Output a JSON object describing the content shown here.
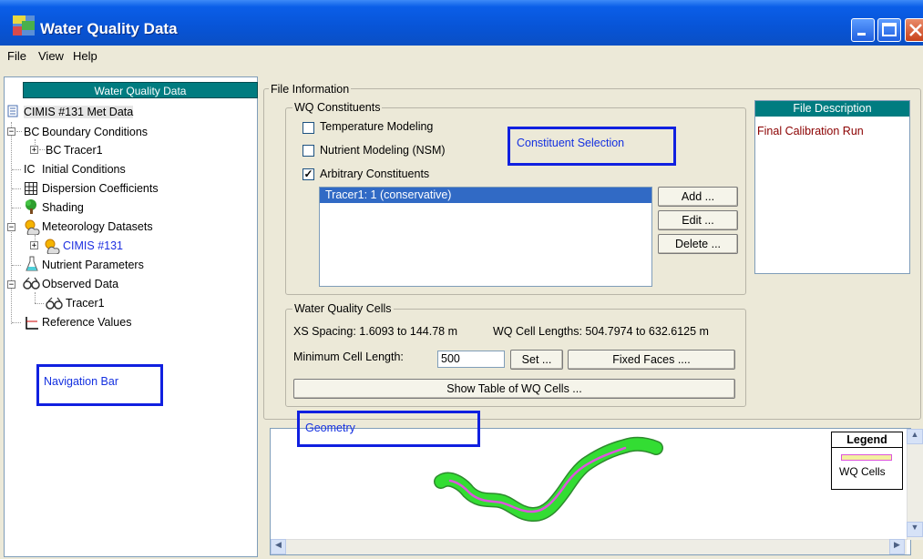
{
  "window": {
    "title": "Water Quality Data"
  },
  "menu": [
    "File",
    "View",
    "Help"
  ],
  "nav": {
    "header": "Water Quality Data",
    "items": [
      "CIMIS #131 Met Data",
      "Boundary Conditions",
      "Tracer1",
      "Initial Conditions",
      "Dispersion Coefficients",
      "Shading",
      "Meteorology Datasets",
      "CIMIS #131",
      "Nutrient Parameters",
      "Observed Data",
      "Tracer1",
      "Reference Values"
    ],
    "bc_prefix": "BC",
    "ic_prefix": "IC"
  },
  "annotations": {
    "navigation_bar": "Navigation Bar",
    "constituent_selection": "Constituent Selection",
    "geometry": "Geometry"
  },
  "file_info": {
    "legend": "File Information",
    "wq_constituents": {
      "legend": "WQ Constituents",
      "checkboxes": [
        {
          "label": "Temperature Modeling",
          "checked": false
        },
        {
          "label": "Nutrient Modeling (NSM)",
          "checked": false
        },
        {
          "label": "Arbitrary Constituents",
          "checked": true
        }
      ],
      "list_items": [
        "Tracer1: 1  (conservative)"
      ],
      "buttons": {
        "add": "Add ...",
        "edit": "Edit ...",
        "delete": "Delete ..."
      }
    },
    "file_description": {
      "header": "File Description",
      "text": "Final Calibration Run"
    },
    "wq_cells": {
      "legend": "Water Quality Cells",
      "xs_spacing": "XS Spacing: 1.6093 to 144.78 m",
      "cell_lengths": "WQ Cell Lengths: 504.7974 to 632.6125 m",
      "min_cell_label": "Minimum Cell Length:",
      "min_cell_value": "500",
      "set_button": "Set ...",
      "fixed_faces_button": "Fixed Faces ....",
      "show_table_button": "Show Table of WQ Cells ..."
    }
  },
  "map_legend": {
    "title": "Legend",
    "item": "WQ Cells"
  },
  "colors": {
    "teal_header": "#007c80",
    "annotation_blue": "#1020e0",
    "river_green": "#33dd33",
    "wq_cells_pink": "#dd88dd",
    "description_text": "#8b0000",
    "selection_blue": "#316ac5"
  }
}
